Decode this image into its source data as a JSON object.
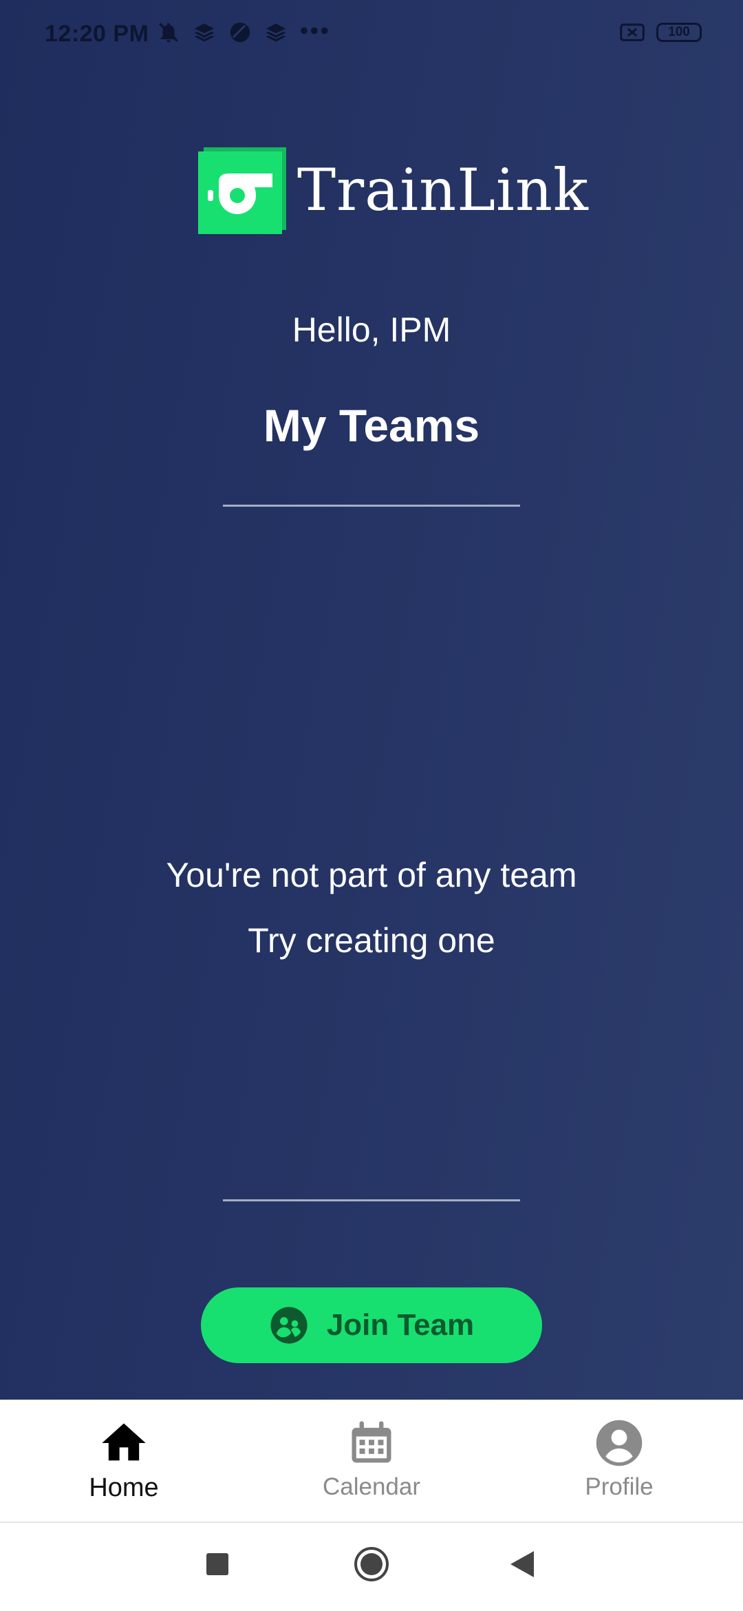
{
  "status_bar": {
    "time": "12:20 PM",
    "icons": [
      "notifications-off-icon",
      "stack-icon",
      "circle-app-icon",
      "stack-icon"
    ],
    "overflow": "•••",
    "battery": "100"
  },
  "app": {
    "name": "TrainLink",
    "greeting": "Hello, IPM",
    "title": "My Teams",
    "empty_state": {
      "title": "You're not part of any team",
      "subtitle": "Try creating one"
    },
    "join_button": {
      "label": "Join Team",
      "icon": "team-icon"
    }
  },
  "bottom_nav": {
    "items": [
      {
        "label": "Home",
        "icon": "home-icon",
        "active": true
      },
      {
        "label": "Calendar",
        "icon": "calendar-icon",
        "active": false
      },
      {
        "label": "Profile",
        "icon": "profile-icon",
        "active": false
      }
    ]
  },
  "system_nav": {
    "buttons": [
      "recents-button",
      "home-button",
      "back-button"
    ]
  },
  "colors": {
    "background_start": "#1f2d5e",
    "background_end": "#2c3c6b",
    "accent_green": "#18e070",
    "button_text": "#0d5a2e"
  }
}
